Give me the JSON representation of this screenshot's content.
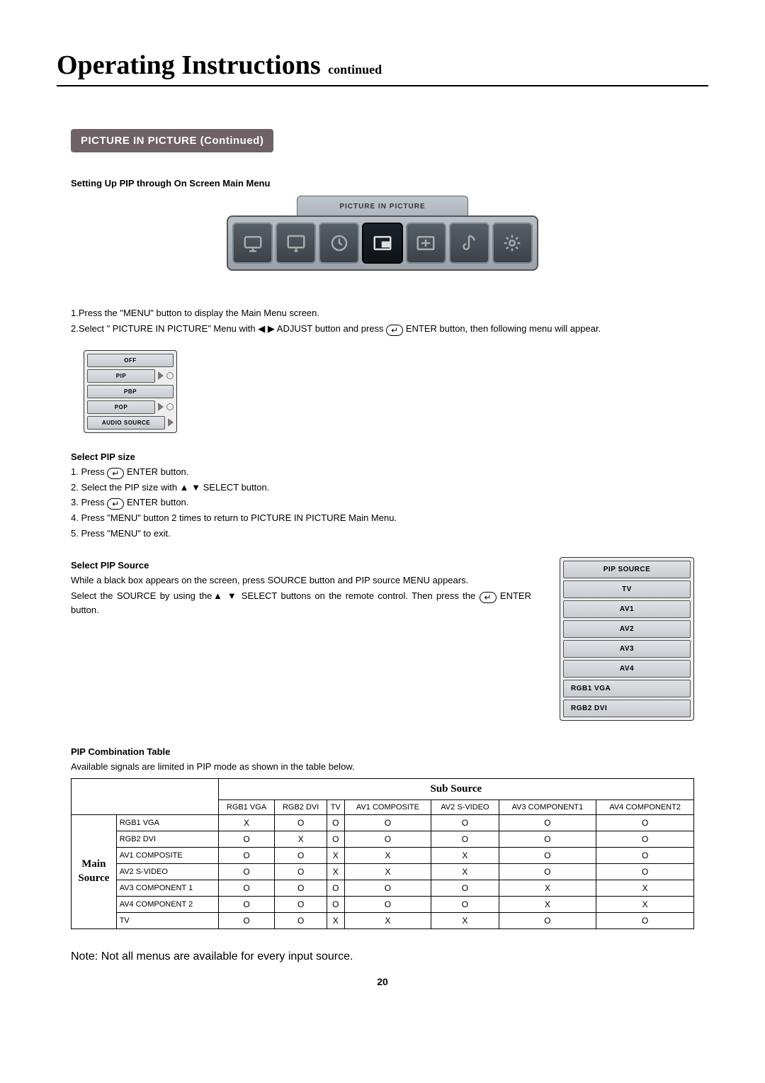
{
  "heading": {
    "title": "Operating Instructions",
    "sub": "continued"
  },
  "section_chip": "PICTURE IN PICTURE (Continued)",
  "subhead_setup": "Setting Up PIP through On Screen Main Menu",
  "pip_scene_label": "PICTURE IN PICTURE",
  "step_intro": {
    "line1": "1.Press the \"MENU\" button to display the Main Menu screen.",
    "line2_a": "2.Select \" PICTURE IN PICTURE\" Menu with ",
    "line2_b": " ADJUST button and press  ",
    "line2_c": "  ENTER button, then following menu will appear."
  },
  "osd_menu": {
    "items": [
      "OFF",
      "PIP",
      "PBP",
      "POP",
      "AUDIO SOURCE"
    ]
  },
  "select_pip_size": {
    "heading": "Select PIP size",
    "steps": [
      "Press   ENTER button.",
      "Select the PIP size with ▲  ▼ SELECT button.",
      "Press   ENTER button.",
      "Press \"MENU\" button 2 times to return to PICTURE IN PICTURE Main Menu.",
      "Press \"MENU\" to exit."
    ]
  },
  "select_pip_source": {
    "heading": "Select PIP Source",
    "p1": "While a black box appears on the screen, press SOURCE button and PIP source MENU appears.",
    "p2_a": "Select the SOURCE by using the▲  ▼ SELECT buttons on the remote control. Then press the ",
    "p2_b": " ENTER button."
  },
  "osd_source": {
    "header": "PIP SOURCE",
    "items": [
      "TV",
      "AV1",
      "AV2",
      "AV3",
      "AV4",
      "RGB1 VGA",
      "RGB2 DVI"
    ]
  },
  "combo": {
    "heading": "PIP Combination Table",
    "intro": "Available signals are limited in PIP mode as shown in the table below.",
    "sub_source_label": "Sub Source",
    "main_source_label": "Main Source"
  },
  "chart_data": {
    "type": "table",
    "title": "PIP Combination Table",
    "columns": [
      "RGB1 VGA",
      "RGB2 DVI",
      "TV",
      "AV1 COMPOSITE",
      "AV2 S-VIDEO",
      "AV3 COMPONENT1",
      "AV4 COMPONENT2"
    ],
    "rows": [
      "RGB1 VGA",
      "RGB2 DVI",
      "AV1 COMPOSITE",
      "AV2 S-VIDEO",
      "AV3 COMPONENT 1",
      "AV4 COMPONENT 2",
      "TV"
    ],
    "cells": [
      [
        "X",
        "O",
        "O",
        "O",
        "O",
        "O",
        "O"
      ],
      [
        "O",
        "X",
        "O",
        "O",
        "O",
        "O",
        "O"
      ],
      [
        "O",
        "O",
        "X",
        "X",
        "X",
        "O",
        "O"
      ],
      [
        "O",
        "O",
        "X",
        "X",
        "X",
        "O",
        "O"
      ],
      [
        "O",
        "O",
        "O",
        "O",
        "O",
        "X",
        "X"
      ],
      [
        "O",
        "O",
        "O",
        "O",
        "O",
        "X",
        "X"
      ],
      [
        "O",
        "O",
        "X",
        "X",
        "X",
        "O",
        "O"
      ]
    ]
  },
  "note": "Note: Not all menus are available for every input source.",
  "page_number": "20"
}
